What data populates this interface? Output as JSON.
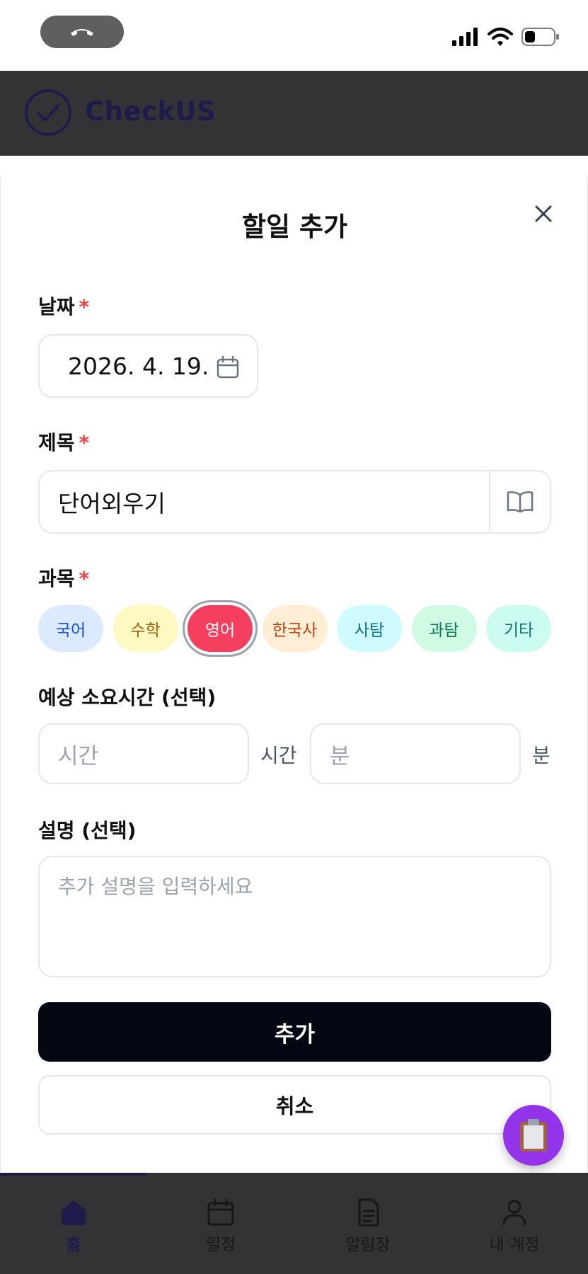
{
  "app": {
    "name": "CheckUS"
  },
  "modal": {
    "title": "할일 추가",
    "date": {
      "label": "날짜",
      "required_mark": "*",
      "value": "2026. 4. 19."
    },
    "todo_title": {
      "label": "제목",
      "required_mark": "*",
      "value": "단어외우기"
    },
    "subject": {
      "label": "과목",
      "required_mark": "*",
      "selected": "영어",
      "options": [
        {
          "label": "국어",
          "bg": "#dbeafe",
          "fg": "#1d4ed8"
        },
        {
          "label": "수학",
          "bg": "#fef9c3",
          "fg": "#a16207"
        },
        {
          "label": "영어",
          "bg": "#f43f5e",
          "fg": "#ffffff"
        },
        {
          "label": "한국사",
          "bg": "#ffedd5",
          "fg": "#c2410c"
        },
        {
          "label": "사탐",
          "bg": "#cffafe",
          "fg": "#0e7490"
        },
        {
          "label": "과탐",
          "bg": "#d1fae5",
          "fg": "#047857"
        },
        {
          "label": "기타",
          "bg": "#ccfbf1",
          "fg": "#0f766e"
        }
      ]
    },
    "duration": {
      "label": "예상 소요시간 (선택)",
      "hours_placeholder": "시간",
      "hours_unit": "시간",
      "minutes_placeholder": "분",
      "minutes_unit": "분"
    },
    "description": {
      "label": "설명 (선택)",
      "placeholder": "추가 설명을 입력하세요"
    },
    "add_button": "추가",
    "cancel_button": "취소"
  },
  "bottom_nav": {
    "items": [
      {
        "label": "홈",
        "icon": "home-icon",
        "active": true
      },
      {
        "label": "일정",
        "icon": "calendar-icon"
      },
      {
        "label": "알림장",
        "icon": "document-icon"
      },
      {
        "label": "내 계정",
        "icon": "user-icon"
      }
    ]
  },
  "colors": {
    "accent": "#1e1b4b",
    "fab": "#9333ea",
    "primary_button": "#030712",
    "required": "#ef4444"
  }
}
